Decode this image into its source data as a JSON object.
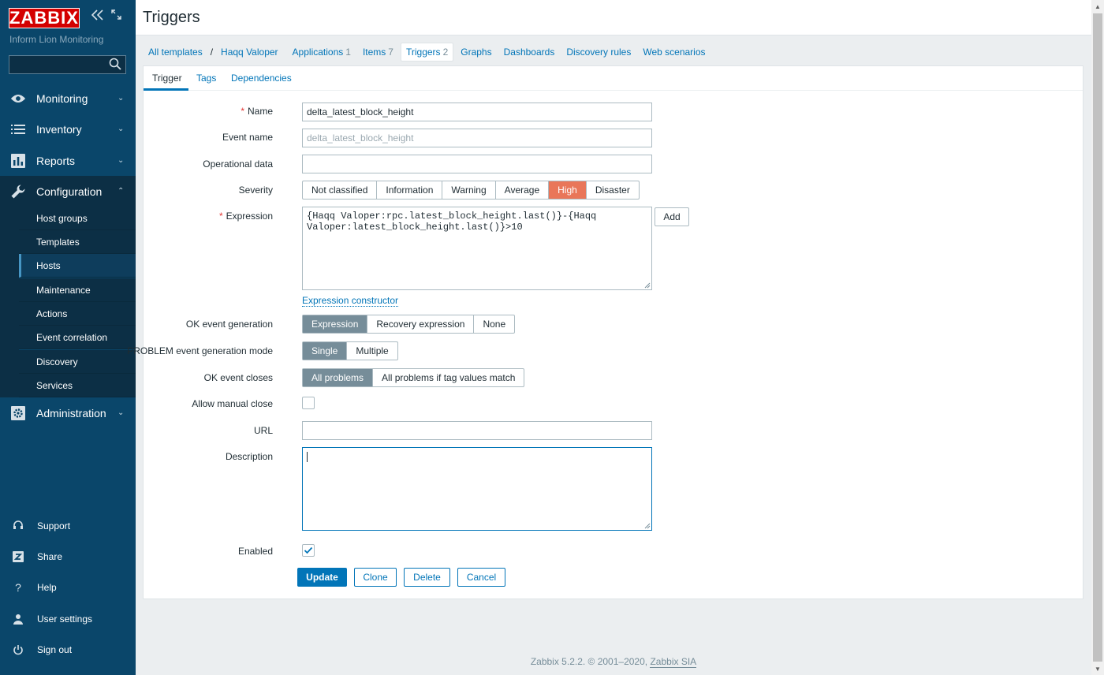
{
  "brand": {
    "logo": "ZABBIX",
    "org": "Inform Lion Monitoring"
  },
  "search": {
    "value": "",
    "placeholder": ""
  },
  "menu": {
    "monitoring": "Monitoring",
    "inventory": "Inventory",
    "reports": "Reports",
    "configuration": "Configuration",
    "administration": "Administration"
  },
  "submenu": [
    "Host groups",
    "Templates",
    "Hosts",
    "Maintenance",
    "Actions",
    "Event correlation",
    "Discovery",
    "Services"
  ],
  "bottom_menu": {
    "support": "Support",
    "share": "Share",
    "help": "Help",
    "user_settings": "User settings",
    "sign_out": "Sign out"
  },
  "page": {
    "title": "Triggers"
  },
  "nav": {
    "all_templates": "All templates",
    "separator": "/",
    "template": "Haqq Valoper",
    "applications": {
      "label": "Applications",
      "count": "1"
    },
    "items": {
      "label": "Items",
      "count": "7"
    },
    "triggers": {
      "label": "Triggers",
      "count": "2"
    },
    "graphs": "Graphs",
    "dashboards": "Dashboards",
    "discovery_rules": "Discovery rules",
    "web_scenarios": "Web scenarios"
  },
  "tabs": {
    "trigger": "Trigger",
    "tags": "Tags",
    "dependencies": "Dependencies"
  },
  "form": {
    "required_mark": "*",
    "name_label": "Name",
    "name_value": "delta_latest_block_height",
    "event_name_label": "Event name",
    "event_name_placeholder": "delta_latest_block_height",
    "operational_data_label": "Operational data",
    "operational_data_value": "",
    "severity_label": "Severity",
    "severity_options": [
      "Not classified",
      "Information",
      "Warning",
      "Average",
      "High",
      "Disaster"
    ],
    "severity_selected": "High",
    "expression_label": "Expression",
    "expression_value": "{Haqq Valoper:rpc.latest_block_height.last()}-{Haqq Valoper:latest_block_height.last()}>10",
    "add_button": "Add",
    "expression_constructor": "Expression constructor",
    "ok_event_generation_label": "OK event generation",
    "ok_event_generation_options": [
      "Expression",
      "Recovery expression",
      "None"
    ],
    "ok_event_generation_selected": "Expression",
    "problem_mode_label": "PROBLEM event generation mode",
    "problem_mode_options": [
      "Single",
      "Multiple"
    ],
    "problem_mode_selected": "Single",
    "ok_event_closes_label": "OK event closes",
    "ok_event_closes_options": [
      "All problems",
      "All problems if tag values match"
    ],
    "ok_event_closes_selected": "All problems",
    "allow_manual_close_label": "Allow manual close",
    "allow_manual_close_checked": false,
    "url_label": "URL",
    "url_value": "",
    "description_label": "Description",
    "description_value": "",
    "enabled_label": "Enabled",
    "enabled_checked": true
  },
  "actions": {
    "update": "Update",
    "clone": "Clone",
    "delete": "Delete",
    "cancel": "Cancel"
  },
  "footer": {
    "text": "Zabbix 5.2.2. © 2001–2020,",
    "link": "Zabbix SIA"
  },
  "colors": {
    "sidebar": "#0a466a",
    "accent": "#0275b8",
    "severity_high": "#e97659",
    "logo_red": "#d40000"
  }
}
